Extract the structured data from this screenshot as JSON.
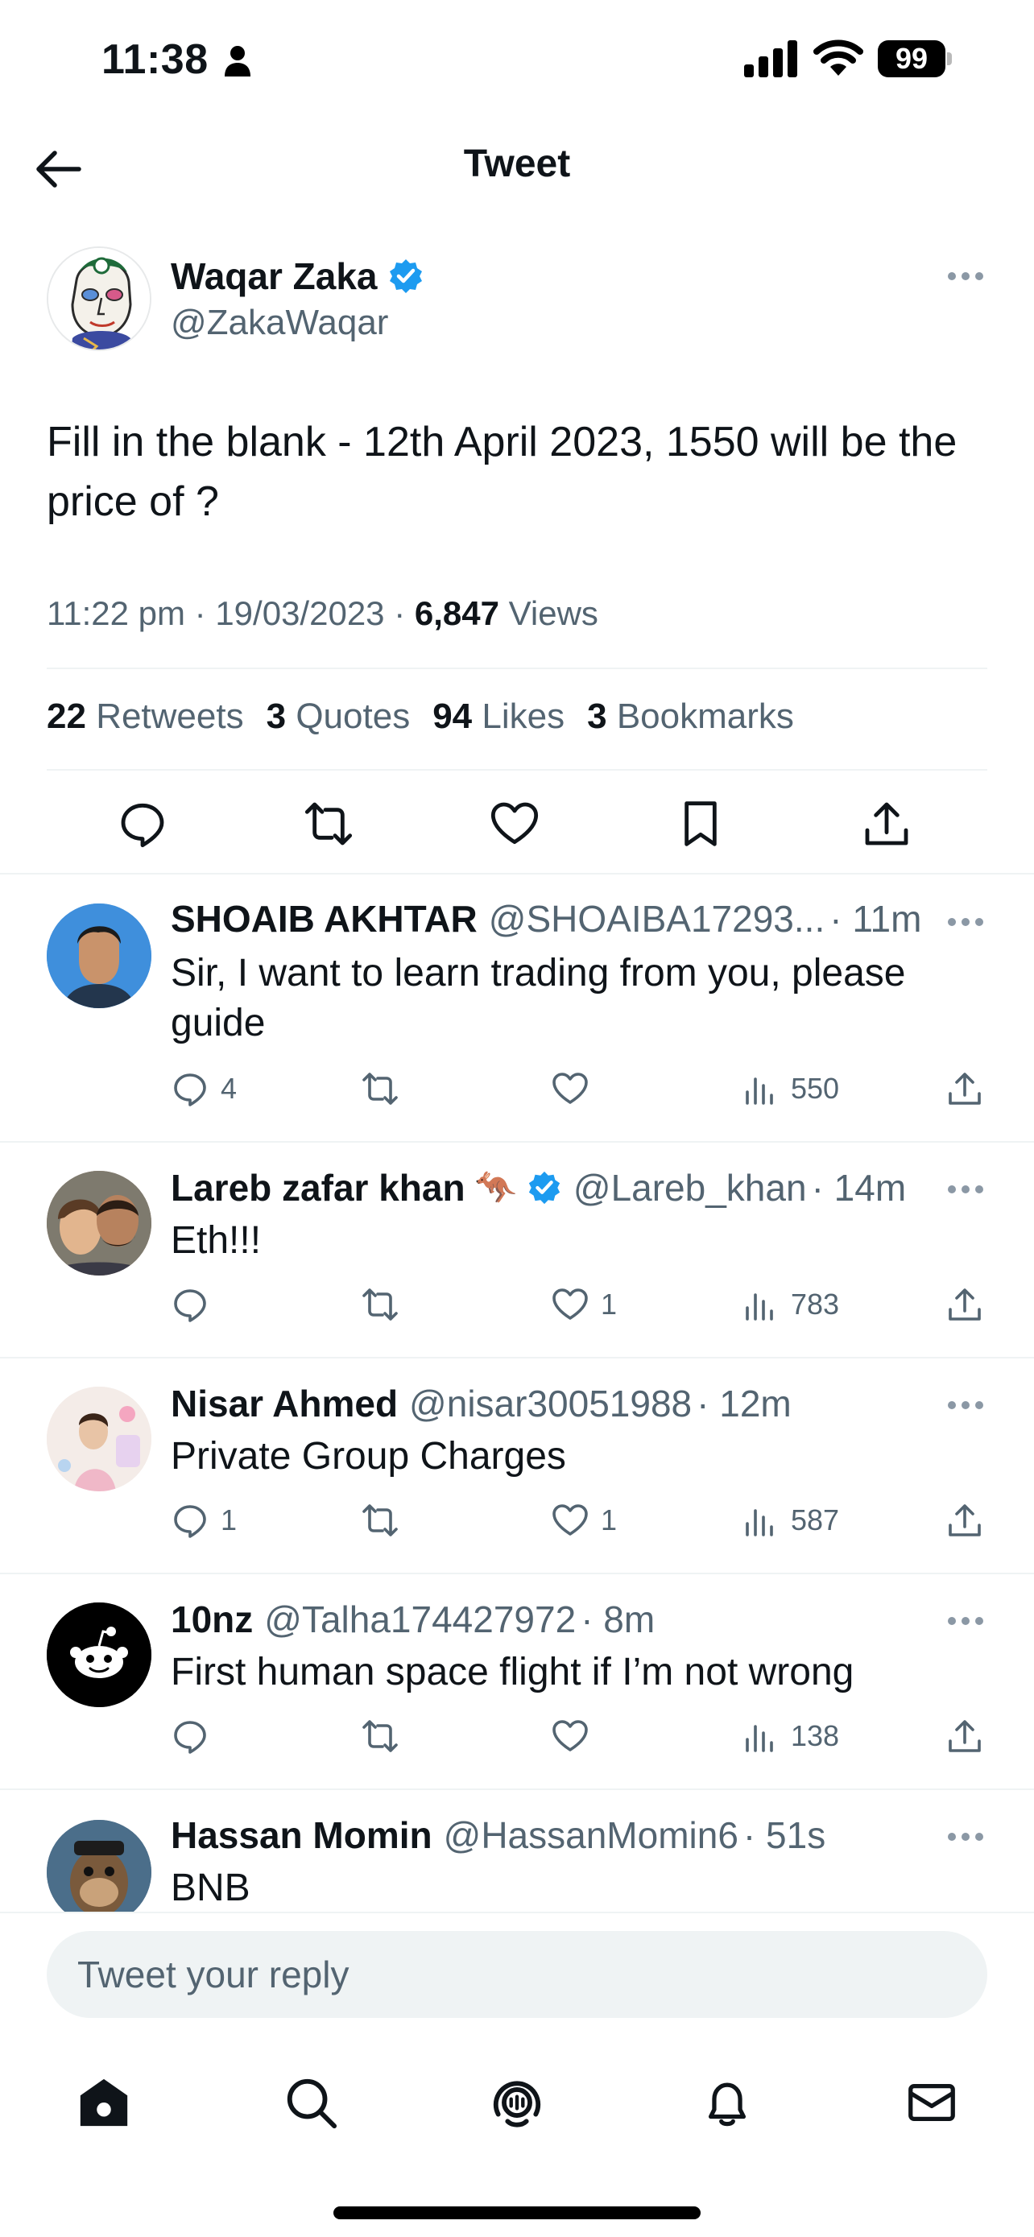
{
  "status_bar": {
    "time": "11:38",
    "battery": "99"
  },
  "header": {
    "title": "Tweet"
  },
  "main_tweet": {
    "author_name": "Waqar Zaka",
    "author_handle": "@ZakaWaqar",
    "text": "Fill in the blank - 12th April 2023, 1550 will be the price of ?",
    "time": "11:22 pm",
    "date": "19/03/2023",
    "views_count": "6,847",
    "views_label": "Views",
    "retweets_count": "22",
    "retweets_label": "Retweets",
    "quotes_count": "3",
    "quotes_label": "Quotes",
    "likes_count": "94",
    "likes_label": "Likes",
    "bookmarks_count": "3",
    "bookmarks_label": "Bookmarks"
  },
  "replies": [
    {
      "name": "SHOAIB AKHTAR",
      "handle": "@SHOAIBA17293...",
      "time": "11m",
      "text": "Sir, I want to learn trading from you, please guide",
      "replies": "4",
      "retweets": "",
      "likes": "",
      "views": "550",
      "verified": false,
      "emoji": ""
    },
    {
      "name": "Lareb zafar khan",
      "handle": "@Lareb_khan",
      "time": "14m",
      "text": "Eth!!!",
      "replies": "",
      "retweets": "",
      "likes": "1",
      "views": "783",
      "verified": true,
      "emoji": "🦘"
    },
    {
      "name": "Nisar Ahmed",
      "handle": "@nisar30051988",
      "time": "12m",
      "text": "Private Group Charges",
      "replies": "1",
      "retweets": "",
      "likes": "1",
      "views": "587",
      "verified": false,
      "emoji": ""
    },
    {
      "name": "10nz",
      "handle": "@Talha174427972",
      "time": "8m",
      "text": "First human space flight if I’m not wrong",
      "replies": "",
      "retweets": "",
      "likes": "",
      "views": "138",
      "verified": false,
      "emoji": ""
    },
    {
      "name": "Hassan Momin",
      "handle": "@HassanMomin6",
      "time": "51s",
      "text": "BNB",
      "verified": false,
      "emoji": ""
    }
  ],
  "reply_box": {
    "placeholder": "Tweet your reply"
  },
  "colors": {
    "verified_blue": "#1d9bf0",
    "text_secondary": "#536471",
    "divider": "#eff3f4"
  },
  "nav": {
    "items": [
      "home-icon",
      "search-icon",
      "spaces-icon",
      "notifications-icon",
      "messages-icon"
    ]
  }
}
